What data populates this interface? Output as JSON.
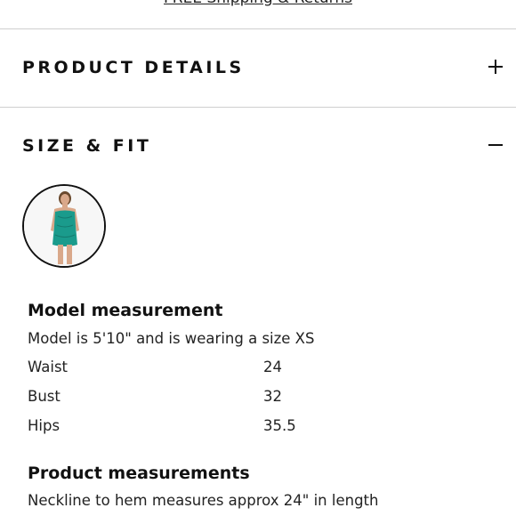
{
  "shipping_link": "FREE Shipping & Returns",
  "accordions": {
    "product_details": {
      "title": "PRODUCT DETAILS",
      "icon": "plus-icon",
      "expanded": false
    },
    "size_fit": {
      "title": "SIZE & FIT",
      "icon": "minus-icon",
      "expanded": true
    }
  },
  "size_fit": {
    "model_thumbnail": {
      "icon": "model-photo-thumbnail",
      "dress_color": "#1a9b8c",
      "skin_color": "#d9a88a",
      "hair_color": "#6b4a2e"
    },
    "model_measurement": {
      "heading": "Model measurement",
      "summary": "Model is 5'10\" and is wearing a size XS",
      "rows": [
        {
          "label": "Waist",
          "value": "24"
        },
        {
          "label": "Bust",
          "value": "32"
        },
        {
          "label": "Hips",
          "value": "35.5"
        }
      ]
    },
    "product_measurements": {
      "heading": "Product measurements",
      "text": "Neckline to hem measures approx 24\" in length"
    }
  }
}
